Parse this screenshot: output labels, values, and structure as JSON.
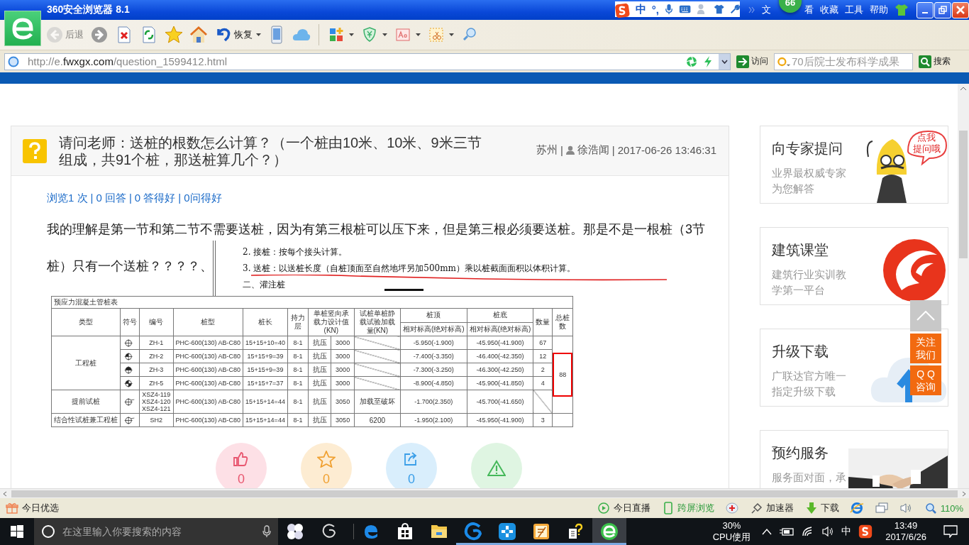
{
  "browser": {
    "title": "360安全浏览器 8.1",
    "badge": "66",
    "menu": [
      {
        "label": "文"
      },
      {
        "label": "看"
      },
      {
        "label": "收藏"
      },
      {
        "label": "工具"
      },
      {
        "label": "帮助"
      }
    ],
    "ime": {
      "mode": "中",
      "punct": "°,"
    },
    "toolbar": [
      {
        "kind": "back",
        "label": "后退",
        "disabled": true,
        "dropdown": false
      },
      {
        "kind": "forward",
        "disabled": false,
        "dropdown": false
      },
      {
        "kind": "stop",
        "disabled": false,
        "dropdown": false
      },
      {
        "kind": "refresh",
        "disabled": false,
        "dropdown": false
      },
      {
        "kind": "favorite",
        "disabled": false,
        "dropdown": false
      },
      {
        "kind": "home",
        "disabled": false,
        "dropdown": false
      },
      {
        "kind": "restore",
        "label": "恢复",
        "disabled": false,
        "dropdown": true
      },
      {
        "kind": "phone",
        "disabled": false,
        "dropdown": false
      },
      {
        "kind": "cloud",
        "disabled": false,
        "dropdown": false
      },
      {
        "kind": "apps",
        "disabled": false,
        "dropdown": true
      },
      {
        "kind": "shield",
        "disabled": false,
        "dropdown": true
      },
      {
        "kind": "font",
        "disabled": false,
        "dropdown": true
      },
      {
        "kind": "screenshot",
        "disabled": false,
        "dropdown": true
      },
      {
        "kind": "magnifier",
        "disabled": false,
        "dropdown": false
      }
    ],
    "address": {
      "scheme": "http://e.",
      "domain": "fwxgx.com",
      "path": "/question_1599412.html",
      "go": "访问",
      "search_placeholder": "70后院士发布科学成果",
      "search_button": "搜索"
    }
  },
  "question": {
    "title": "请问老师：送桩的根数怎么计算？（一个桩由10米、10米、9米三节组成，共91个桩，那送桩算几个？）",
    "location": "苏州",
    "separators": [
      "|",
      "|"
    ],
    "author": "徐浩闻",
    "time": "2017-06-26 13:46:31",
    "stats": [
      {
        "label": "浏览1 次"
      },
      {
        "separator": "|",
        "label": "0 回答"
      },
      {
        "separator": "|",
        "label": "0 答得好"
      },
      {
        "separator": "|",
        "label": "0问得好"
      }
    ],
    "body": [
      "我的理解是第一节和第二节不需要送桩，因为有第三根桩可以压下来，但是第三根必须要送桩。那是不是一根桩（3节",
      "桩）只有一个送桩？？？？、"
    ],
    "excerpt": [
      "2. 接桩：按每个接头计算。",
      "3. 送桩：以送桩长度（自桩顶面至自然地坪另加500mm）乘以桩截面面积以体积计算。",
      "二、灌注桩"
    ],
    "table": {
      "caption": "预应力混凝土管桩表",
      "headers": {
        "type": "类型",
        "symbol": "符号",
        "code": "编号",
        "model": "桩型",
        "length": "桩长",
        "layer": "持力层",
        "capacity": "单桩竖向承载力设计值(KN)",
        "test_load": "试桩单桩静载试验加载量(KN)",
        "top": "桩顶",
        "bottom": "桩底",
        "top_sub": "相对标高(绝对标高)",
        "bottom_sub": "相对标高(绝对标高)",
        "count": "数量",
        "total": "总桩数"
      },
      "sections": [
        {
          "total": {
            "value": "88",
            "highlighted": true
          },
          "groups": [
            {
              "type": "工程桩",
              "rows": [
                {
                  "kind": "empty",
                  "codes": [
                    "ZH-1"
                  ],
                  "model": "PHC-600(130) AB-C80",
                  "length": "15+15+10=40",
                  "layer": "8-1",
                  "mode": "抗压",
                  "capacity": "3000",
                  "top": "-5.950(-1.900)",
                  "bottom": "-45.950(-41.900)",
                  "count": "67"
                },
                {
                  "kind": "quarter",
                  "codes": [
                    "ZH-2"
                  ],
                  "model": "PHC-600(130) AB-C80",
                  "length": "15+15+9=39",
                  "layer": "8-1",
                  "mode": "抗压",
                  "capacity": "3000",
                  "top": "-7.400(-3.350)",
                  "bottom": "-46.400(-42.350)",
                  "count": "12"
                },
                {
                  "kind": "half",
                  "codes": [
                    "ZH-3"
                  ],
                  "model": "PHC-600(130) AB-C80",
                  "length": "15+15+9=39",
                  "layer": "8-1",
                  "mode": "抗压",
                  "capacity": "3000",
                  "top": "-7.300(-3.250)",
                  "bottom": "-46.300(-42.250)",
                  "count": "2"
                },
                {
                  "kind": "checker",
                  "codes": [
                    "ZH-5"
                  ],
                  "model": "PHC-600(130) AB-C80",
                  "length": "15+15+7=37",
                  "layer": "8-1",
                  "mode": "抗压",
                  "capacity": "3000",
                  "top": "-8.900(-4.850)",
                  "bottom": "-45.900(-41.850)",
                  "count": "4"
                }
              ]
            },
            {
              "type": "提前试桩",
              "rows": [
                {
                  "kind": "tagged",
                  "codes": [
                    "XSZ4-119",
                    "XSZ4-120",
                    "XSZ4-121"
                  ],
                  "model": "PHC-600(130) AB-C80",
                  "length": "15+15+14=44",
                  "layer": "8-1",
                  "mode": "抗压",
                  "capacity": "3050",
                  "test_load": "加载至破坏",
                  "top": "-1.700(2.350)",
                  "bottom": "-45.700(-41.650)"
                }
              ]
            }
          ]
        },
        {
          "groups": [
            {
              "type": "结合性试桩兼工程桩",
              "rows": [
                {
                  "kind": "tagged",
                  "codes": [
                    "SH2"
                  ],
                  "model": "PHC-600(130) AB-C80",
                  "length": "15+15+14=44",
                  "layer": "8-1",
                  "mode": "抗压",
                  "capacity": "3050",
                  "test_load": "6200",
                  "top": "-1.950(2.100)",
                  "bottom": "-45.950(-41.900)",
                  "count": "3"
                }
              ]
            }
          ]
        }
      ]
    },
    "actions": [
      {
        "kind": "like",
        "count": "0"
      },
      {
        "kind": "star",
        "count": "0"
      },
      {
        "kind": "share",
        "count": "0"
      },
      {
        "kind": "report"
      }
    ]
  },
  "sidebar": [
    {
      "kind": "expert",
      "title": "向专家提问",
      "lines": [
        "业界最权威专家",
        "为您解答"
      ],
      "bubble": [
        "点我",
        "提问哦"
      ]
    },
    {
      "kind": "course",
      "title": "建筑课堂",
      "lines": [
        "建筑行业实训教",
        "学第一平台"
      ]
    },
    {
      "kind": "download",
      "title": "升级下载",
      "lines": [
        "广联达官方唯一",
        "指定升级下载"
      ]
    },
    {
      "kind": "service",
      "title": "预约服务",
      "lines": [
        "服务面对面，承"
      ]
    }
  ],
  "float": {
    "follow": [
      "关注",
      "我们"
    ],
    "qq": [
      "Q Q",
      "咨询"
    ]
  },
  "status": {
    "left": "今日优选",
    "items": [
      {
        "kind": "live",
        "label": "今日直播"
      },
      {
        "kind": "cross",
        "label": "跨屏浏览"
      },
      {
        "kind": "medic"
      },
      {
        "kind": "accel",
        "label": "加速器"
      },
      {
        "kind": "download",
        "label": "下载"
      },
      {
        "kind": "ie"
      },
      {
        "kind": "windows"
      },
      {
        "kind": "sound"
      },
      {
        "kind": "zoom",
        "label": "110%"
      }
    ]
  },
  "taskbar": {
    "search_placeholder": "在这里输入你要搜索的内容",
    "apps": [
      {
        "kind": "pinwheel",
        "running": false,
        "selected": false
      },
      {
        "kind": "swirl",
        "running": false,
        "selected": false
      },
      {
        "kind": "edge",
        "running": false,
        "selected": false
      },
      {
        "kind": "store",
        "running": false,
        "selected": false
      },
      {
        "kind": "folder",
        "running": false,
        "selected": false
      },
      {
        "kind": "spiral",
        "running": true,
        "selected": false
      },
      {
        "kind": "cross",
        "running": true,
        "selected": false
      },
      {
        "kind": "notes",
        "running": true,
        "selected": false
      },
      {
        "kind": "help",
        "running": true,
        "selected": false
      },
      {
        "kind": "browser",
        "running": true,
        "selected": true
      }
    ],
    "cpu": "30%",
    "cpu_label": "CPU使用",
    "ime": "中",
    "time": "13:49",
    "date": "2017/6/26"
  }
}
